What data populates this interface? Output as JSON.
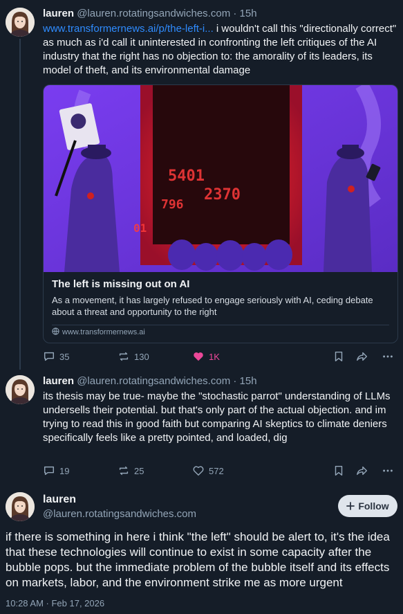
{
  "thread_post_1": {
    "author_name": "lauren",
    "author_handle": "@lauren.rotatingsandwiches.com",
    "separator": "·",
    "time": "15h",
    "link_text": "www.transformernews.ai/p/the-left-i...",
    "text": " i wouldn't call this \"directionally correct\" as much as i'd call it uninterested in confronting the left critiques of the AI industry that the right has no objection to: the amorality of its leaders, its model of theft, and its environmental damage",
    "embed": {
      "image_numbers": [
        "5401",
        "2370",
        "796",
        "01"
      ],
      "title": "The left is missing out on AI",
      "description": "As a movement, it has largely refused to engage seriously with AI, ceding debate about a threat and opportunity to the right",
      "domain": "www.transformernews.ai"
    },
    "actions": {
      "replies": "35",
      "reposts": "130",
      "likes": "1K"
    }
  },
  "thread_post_2": {
    "author_name": "lauren",
    "author_handle": "@lauren.rotatingsandwiches.com",
    "separator": "·",
    "time": "15h",
    "text": "its thesis may be true- maybe the \"stochastic parrot\" understanding of LLMs undersells their potential. but that's only part of the actual objection. and im trying to read this in good faith but comparing AI skeptics to climate deniers specifically feels like a pretty pointed, and loaded, dig",
    "actions": {
      "replies": "19",
      "reposts": "25",
      "likes": "572"
    }
  },
  "main_post": {
    "author_name": "lauren",
    "author_handle": "@lauren.rotatingsandwiches.com",
    "follow_label": "Follow",
    "text": "if there is something in here i think \"the left\" should be alert to, it's the idea that these technologies will continue to exist in some capacity after the bubble pops. but the immediate problem of the bubble itself and its effects on markets, labor, and the environment strike me as more urgent",
    "timestamp": "10:28 AM · Feb 17, 2026"
  },
  "colors": {
    "background": "#151d28",
    "link": "#2f8cff",
    "like_active": "#ec4899",
    "muted": "#93a5b7"
  },
  "icons": [
    "reply-icon",
    "repost-icon",
    "heart-icon",
    "bookmark-icon",
    "share-icon",
    "more-icon",
    "globe-icon",
    "plus-icon"
  ]
}
